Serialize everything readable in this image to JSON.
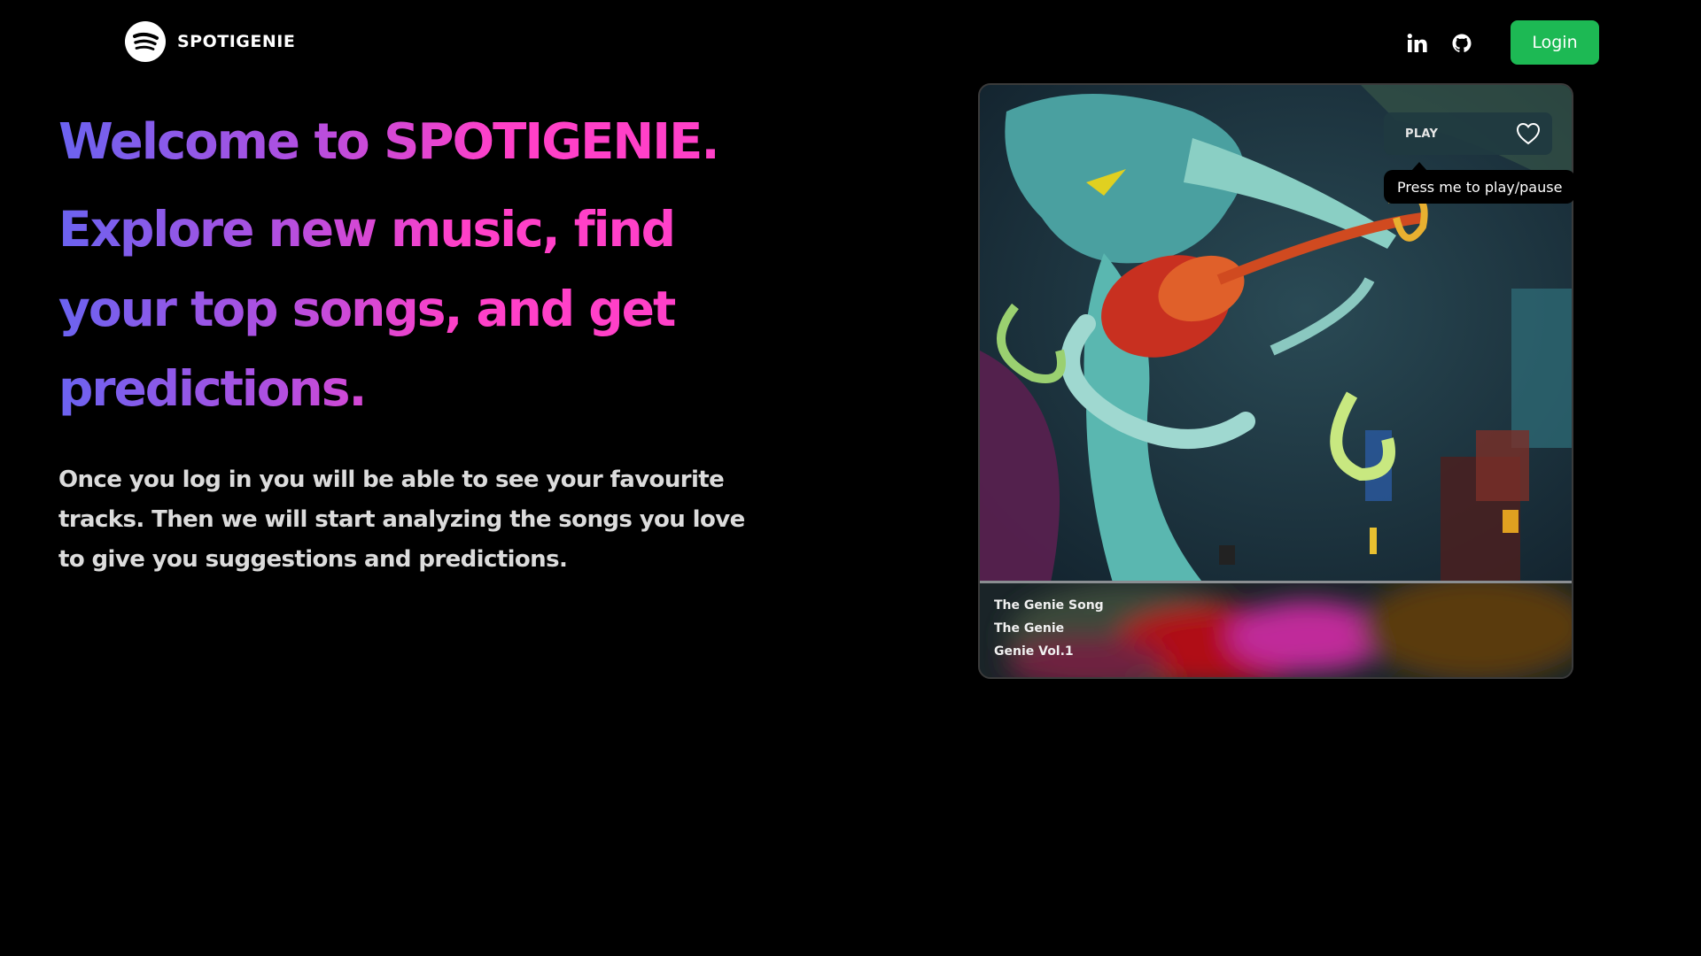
{
  "header": {
    "brand_name": "SPOTIGENIE",
    "login_label": "Login",
    "icons": [
      "spotify-logo-icon",
      "linkedin-icon",
      "github-icon"
    ]
  },
  "hero": {
    "welcome": "Welcome to SPOTIGENIE.",
    "tagline": "Explore new music, find your top songs, and get predictions.",
    "description": "Once you log in you will be able to see your favourite tracks. Then we will start analyzing the songs you love to give you suggestions and predictions."
  },
  "player": {
    "play_label": "PLAY",
    "tooltip": "Press me to play/pause",
    "track_title": "The Genie Song",
    "artist": "The Genie",
    "album": "Genie Vol.1",
    "icons": [
      "heart-icon"
    ]
  },
  "colors": {
    "background": "#000000",
    "accent_green": "#1db954",
    "gradient_start": "#6b63f0",
    "gradient_end": "#ff40c8",
    "description_text": "#dcdcdc"
  }
}
